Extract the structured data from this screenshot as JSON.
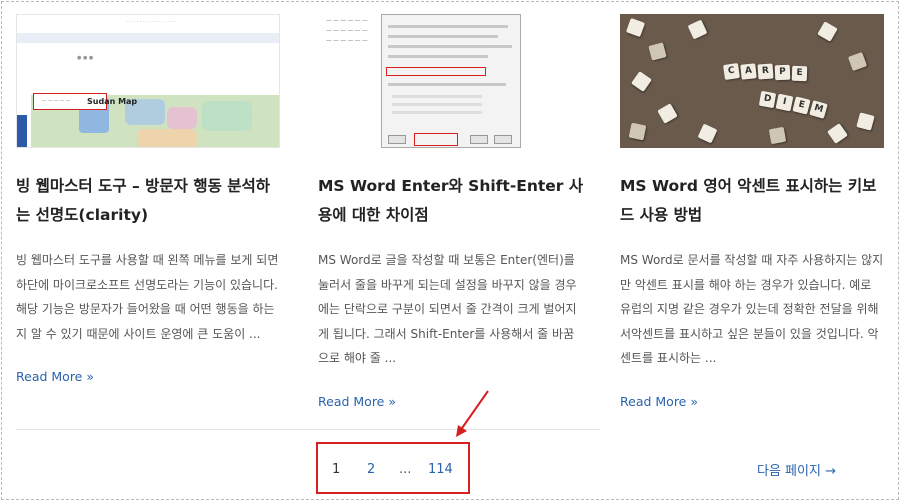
{
  "posts": [
    {
      "title": "빙 웹마스터 도구 – 방문자 행동 분석하는 선명도(clarity)",
      "excerpt": "빙 웹마스터 도구를 사용할 때 왼쪽 메뉴를 보게 되면 하단에 마이크로소프트 선명도라는 기능이 있습니다. 해당 기능은 방문자가 들어왔을 때 어떤 행동을 하는지 알 수 있기 때문에 사이트 운영에 큰 도움이 ...",
      "read_more": "Read More »",
      "thumb_label": "Sudan Map"
    },
    {
      "title": "MS Word Enter와 Shift-Enter 사용에 대한 차이점",
      "excerpt": "MS Word로 글을 작성할 때 보통은 Enter(엔터)를 눌러서 줄을 바꾸게 되는데 설정을 바꾸지 않을 경우에는 단락으로 구분이 되면서 줄 간격이 크게 벌어지게 됩니다. 그래서 Shift-Enter를 사용해서 줄 바꿈으로 해야 줄 ...",
      "read_more": "Read More »"
    },
    {
      "title": "MS Word 영어 악센트 표시하는 키보드 사용 방법",
      "excerpt": "MS Word로 문서를 작성할 때 자주 사용하지는 않지만 악센트 표시를 해야 하는 경우가 있습니다. 예로 유럽의 지명 같은 경우가 있는데 정확한 전달을 위해서악센트를 표시하고 싶은 분들이 있을 것입니다. 악센트를 표시하는 ...",
      "read_more": "Read More »",
      "tiles": [
        "C",
        "A",
        "R",
        "P",
        "E",
        "D",
        "I",
        "E",
        "M"
      ]
    }
  ],
  "pagination": {
    "pages": [
      "1",
      "2",
      "...",
      "114"
    ],
    "current": "1",
    "next": "다음 페이지 →"
  },
  "colors": {
    "link": "#2a63ad",
    "highlight": "#d62020",
    "title": "#222222"
  }
}
